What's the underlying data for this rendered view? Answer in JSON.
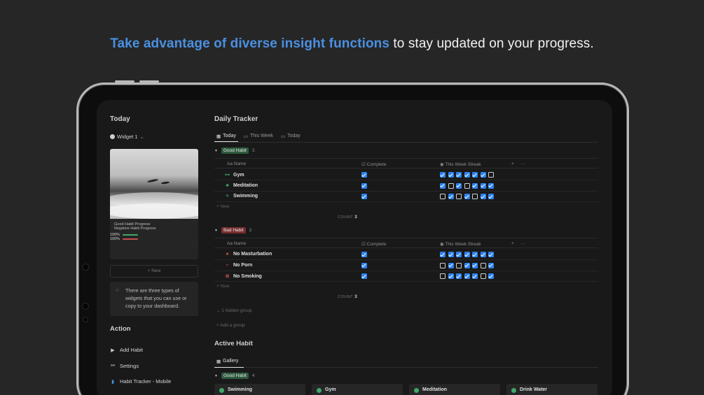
{
  "headline": {
    "highlight": "Take advantage of diverse insight functions",
    "rest": " to stay updated on your progress."
  },
  "left": {
    "title": "Today",
    "widget_label": "Widget 1",
    "progress": [
      {
        "label": "Good Habit Progress",
        "value": "100%",
        "fraction": 1.0,
        "color": "#3fa86b"
      },
      {
        "label": "Negative Habit Progress",
        "value": "100%",
        "fraction": 1.0,
        "color": "#c0504d"
      }
    ],
    "new_label": "+ New",
    "note": "There are three types of widgets that you can use or copy to your dashboard.",
    "action_title": "Action",
    "actions": [
      {
        "label": "Add Habit",
        "icon": "play-icon"
      },
      {
        "label": "Settings",
        "icon": "link-icon"
      },
      {
        "label": "Habit Tracker - Mobile",
        "icon": "phone-icon"
      }
    ]
  },
  "main": {
    "title": "Daily Tracker",
    "tabs": [
      {
        "label": "Today",
        "icon": "table-icon",
        "active": true
      },
      {
        "label": "This Week",
        "icon": "calendar-icon",
        "active": false
      },
      {
        "label": "Today",
        "icon": "calendar-icon",
        "active": false
      }
    ],
    "columns": {
      "name": "Aa Name",
      "complete": "Complete",
      "streak": "This Week Streak",
      "plus": "+",
      "more": "···"
    },
    "groups": [
      {
        "tag": "Good Habit",
        "count": "3",
        "kind": "good",
        "rows": [
          {
            "name": "Gym",
            "icon": "dumbbell-icon",
            "complete": true,
            "streak": [
              1,
              1,
              1,
              1,
              1,
              1,
              0
            ]
          },
          {
            "name": "Meditation",
            "icon": "meditation-icon",
            "complete": true,
            "streak": [
              1,
              0,
              1,
              0,
              1,
              1,
              1
            ]
          },
          {
            "name": "Swimming",
            "icon": "swimming-icon",
            "complete": true,
            "streak": [
              0,
              1,
              0,
              1,
              0,
              1,
              1
            ]
          }
        ]
      },
      {
        "tag": "Bad Habit",
        "count": "3",
        "kind": "bad",
        "rows": [
          {
            "name": "No Masturbation",
            "icon": "flame-icon",
            "complete": true,
            "streak": [
              1,
              1,
              1,
              1,
              1,
              1,
              1
            ]
          },
          {
            "name": "No Porn",
            "icon": "bed-icon",
            "complete": true,
            "streak": [
              0,
              1,
              0,
              1,
              1,
              0,
              1
            ]
          },
          {
            "name": "No Smoking",
            "icon": "no-smoking-icon",
            "complete": true,
            "streak": [
              0,
              1,
              1,
              1,
              1,
              0,
              1
            ]
          }
        ]
      }
    ],
    "new_label": "+ New",
    "count_label": "COUNT",
    "count_value": "3",
    "hidden_group": "1 hidden group",
    "add_group": "+ Add a group",
    "active_title": "Active Habit",
    "gallery_tab": "Gallery",
    "gallery_tag": "Good Habit",
    "gallery_count": "4",
    "gallery": [
      "Swimming",
      "Gym",
      "Meditation",
      "Drink Water"
    ]
  }
}
